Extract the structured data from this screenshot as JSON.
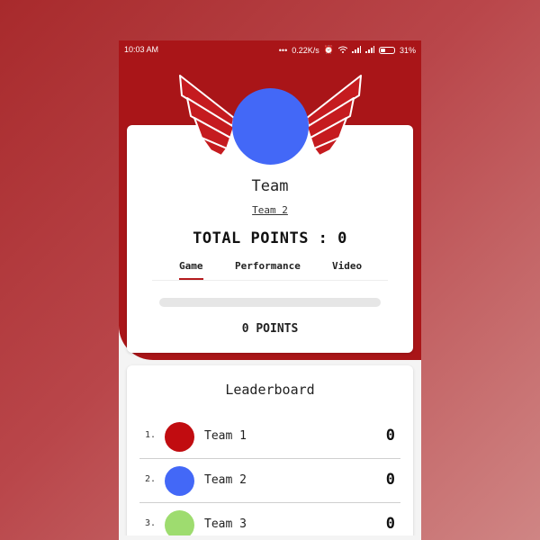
{
  "status_bar": {
    "time": "10:03 AM",
    "network_speed": "0.22K/s",
    "battery": "31%"
  },
  "team_card": {
    "title": "Team",
    "subtitle": "Team 2",
    "total_points": "TOTAL POINTS : 0",
    "tabs": [
      {
        "label": "Game",
        "active": true
      },
      {
        "label": "Performance",
        "active": false
      },
      {
        "label": "Video",
        "active": false
      }
    ],
    "progress_fraction": 0,
    "points_label": "0 POINTS"
  },
  "leaderboard": {
    "title": "Leaderboard",
    "rows": [
      {
        "rank": "1.",
        "name": "Team 1",
        "score": "0",
        "color": "#c10c10"
      },
      {
        "rank": "2.",
        "name": "Team 2",
        "score": "0",
        "color": "#4368f7"
      },
      {
        "rank": "3.",
        "name": "Team 3",
        "score": "0",
        "color": "#9edc6f"
      }
    ]
  },
  "colors": {
    "header_red": "#a91518",
    "team_blue": "#4368f7",
    "tab_accent": "#b41b1e"
  }
}
